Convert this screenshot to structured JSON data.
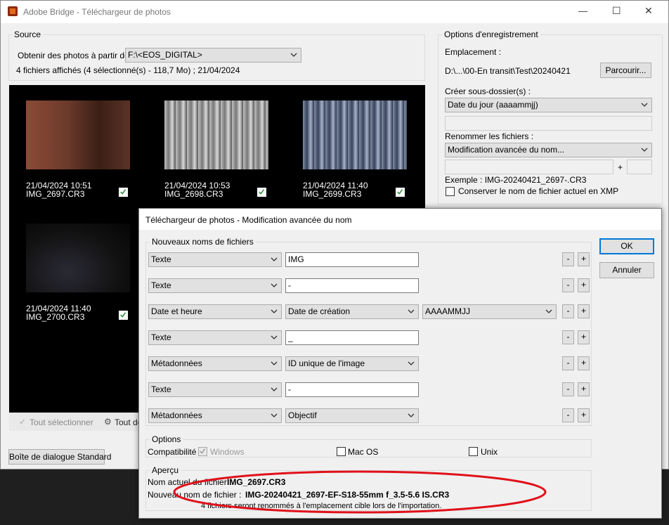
{
  "main_window": {
    "title": "Adobe Bridge - Téléchargeur de photos",
    "controls": {
      "minimize": "—",
      "maximize": "☐",
      "close": "✕"
    }
  },
  "source": {
    "group_label": "Source",
    "get_from_label": "Obtenir des photos à partir de :",
    "get_from_value": "F:\\<EOS_DIGITAL>",
    "summary": "4 fichiers affichés (4 sélectionné(s) - 118,7 Mo) ; 21/04/2024"
  },
  "thumbnails": [
    {
      "date": "21/04/2024 10:51",
      "file": "IMG_2697.CR3",
      "checked": true
    },
    {
      "date": "21/04/2024 10:53",
      "file": "IMG_2698.CR3",
      "checked": true
    },
    {
      "date": "21/04/2024 11:40",
      "file": "IMG_2699.CR3",
      "checked": true
    },
    {
      "date": "21/04/2024 11:40",
      "file": "IMG_2700.CR3",
      "checked": true
    }
  ],
  "bottom_bar": {
    "select_all": "Tout sélectionner",
    "deselect_all": "Tout dé"
  },
  "standard_dialog_button": "Boîte de dialogue Standard",
  "save_options": {
    "group_label": "Options d'enregistrement",
    "location_label": "Emplacement :",
    "location_path": "D:\\...\\00-En transit\\Test\\20240421",
    "browse_button": "Parcourir...",
    "subfolder_label": "Créer sous-dossier(s) :",
    "subfolder_value": "Date du jour (aaaammjj)",
    "rename_label": "Renommer les fichiers :",
    "rename_value": "Modification avancée du nom...",
    "plus": "+",
    "example": "Exemple :  IMG-20240421_2697-.CR3",
    "keep_name_xmp": "Conserver le nom de fichier actuel en XMP"
  },
  "dialog": {
    "title": "Téléchargeur de photos - Modification avancée du nom",
    "new_names_label": "Nouveaux noms de fichiers",
    "ok": "OK",
    "cancel": "Annuler",
    "minus": "-",
    "plus": "+",
    "rows": [
      {
        "type": "Texte",
        "value": "IMG"
      },
      {
        "type": "Texte",
        "value": "-"
      },
      {
        "type": "Date et heure",
        "sub": "Date de création",
        "format": "AAAAMMJJ"
      },
      {
        "type": "Texte",
        "value": "_"
      },
      {
        "type": "Métadonnées",
        "sub": "ID unique de l'image"
      },
      {
        "type": "Texte",
        "value": "-"
      },
      {
        "type": "Métadonnées",
        "sub": "Objectif"
      }
    ],
    "options": {
      "label": "Options",
      "compat_label": "Compatibilité :",
      "windows": "Windows",
      "macos": "Mac OS",
      "unix": "Unix"
    },
    "preview": {
      "label": "Aperçu",
      "current_label": "Nom actuel du fichier :",
      "current_value": "IMG_2697.CR3",
      "new_label": "Nouveau nom de fichier :",
      "new_value": "IMG-20240421_2697-EF-S18-55mm f_3.5-5.6 IS.CR3",
      "note": "4 fichiers seront renommés à l'emplacement cible lors de l'importation."
    }
  },
  "colors": {
    "window_bg": "#f0f0f0",
    "thumb_bg": "#000000",
    "accent": "#0078d7",
    "annotation": "#e0101a"
  }
}
